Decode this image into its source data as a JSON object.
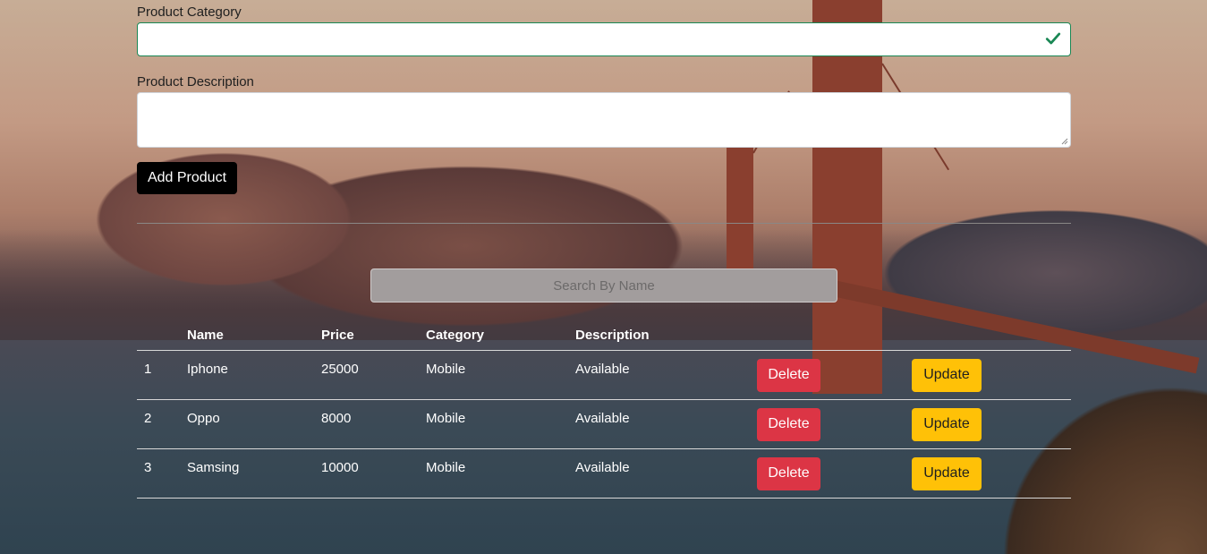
{
  "form": {
    "category_label": "Product Category",
    "category_value": "",
    "description_label": "Product Description",
    "description_value": "",
    "add_button": "Add Product"
  },
  "search": {
    "placeholder": "Search By Name"
  },
  "table": {
    "headers": [
      "",
      "Name",
      "Price",
      "Category",
      "Description"
    ],
    "rows": [
      {
        "num": "1",
        "name": "Iphone",
        "price": "25000",
        "category": "Mobile",
        "description": "Available"
      },
      {
        "num": "2",
        "name": "Oppo",
        "price": "8000",
        "category": "Mobile",
        "description": "Available"
      },
      {
        "num": "3",
        "name": "Samsing",
        "price": "10000",
        "category": "Mobile",
        "description": "Available"
      }
    ],
    "delete_label": "Delete",
    "update_label": "Update"
  },
  "colors": {
    "delete": "#dc3545",
    "update": "#ffc107",
    "valid": "#198754"
  }
}
